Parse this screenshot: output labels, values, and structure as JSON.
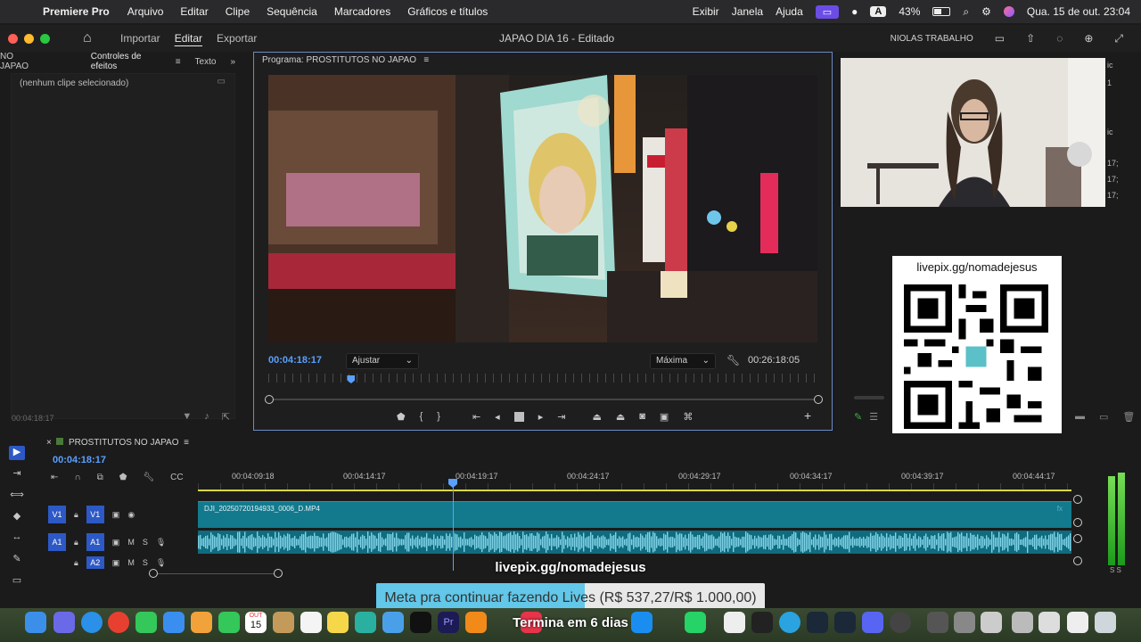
{
  "menubar": {
    "app_name": "Premiere Pro",
    "menus": [
      "Arquivo",
      "Editar",
      "Clipe",
      "Sequência",
      "Marcadores",
      "Gráficos e títulos"
    ],
    "right_menus": [
      "Exibir",
      "Janela",
      "Ajuda"
    ],
    "keyboard_layout": "A",
    "battery": "43%",
    "datetime": "Qua. 15 de out.  23:04"
  },
  "titlebar": {
    "tabs": [
      "Importar",
      "Editar",
      "Exportar"
    ],
    "active_tab": "Editar",
    "document_title": "JAPAO DIA 16 - Editado",
    "workspace": "NIOLAS TRABALHO"
  },
  "left_panel": {
    "tab_source": "NO JAPAO",
    "tab_effects": "Controles de efeitos",
    "tab_text": "Texto",
    "empty_note": "(nenhum clipe selecionado)",
    "timecode": "00:04:18:17"
  },
  "program_monitor": {
    "header": "Programa: PROSTITUTOS NO JAPAO",
    "current_time": "00:04:18:17",
    "fit": "Ajustar",
    "quality": "Máxima",
    "duration": "00:26:18:05",
    "playhead_fraction": 0.15
  },
  "right_panel": {
    "qr_title": "livepix.gg/nomadejesus",
    "side_labels": [
      "ic",
      "1",
      "ic",
      "17;",
      "17;",
      "17;"
    ]
  },
  "timeline": {
    "sequence_name": "PROSTITUTOS NO JAPAO",
    "current_time": "00:04:18:17",
    "ruler_labels": [
      "00:04:09:18",
      "00:04:14:17",
      "00:04:19:17",
      "00:04:24:17",
      "00:04:29:17",
      "00:04:34:17",
      "00:04:39:17",
      "00:04:44:17"
    ],
    "tracks": [
      {
        "name": "V1",
        "target": "V1"
      },
      {
        "name": "A1",
        "target": "A1"
      },
      {
        "name": "A2",
        "target": "A2"
      }
    ],
    "clip_name": "DJI_20250720194933_0006_D.MP4",
    "mute_label": "M",
    "solo_label": "S",
    "meter_label": "S  S"
  },
  "overlay": {
    "link": "livepix.gg/nomadejesus",
    "goal_text": "Meta pra continuar fazendo Lives (R$ 537,27/R$ 1.000,00)",
    "goal_raised": 537.27,
    "goal_target": 1000.0,
    "caption": "Termina em 6 dias"
  },
  "dock": {
    "calendar_month": "OUT",
    "calendar_day": "15"
  },
  "colors": {
    "accent_blue": "#2d59c6",
    "timecode_blue": "#5aa0ff",
    "clip_teal": "#137a8e",
    "monitor_border": "#6c8ac7"
  }
}
